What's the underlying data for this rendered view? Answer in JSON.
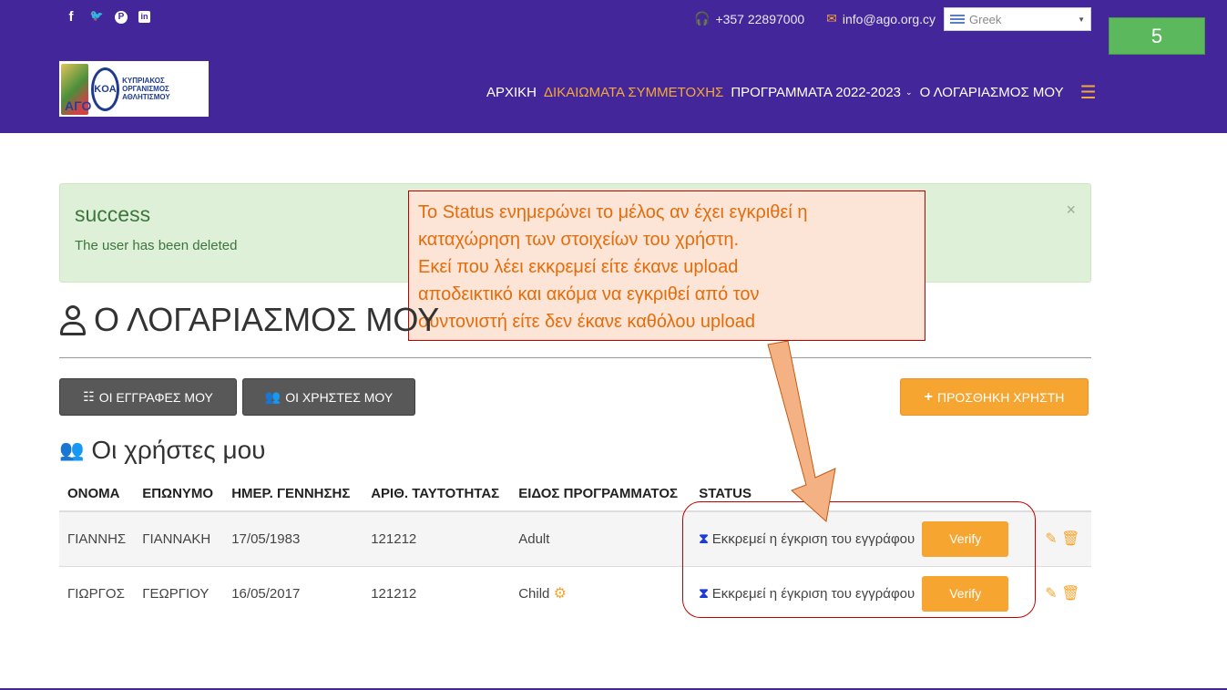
{
  "header": {
    "social": [
      "f",
      "🐦",
      "P",
      "in"
    ],
    "phone": "+357 22897000",
    "email": "info@ago.org.cy",
    "language": "Greek",
    "logo_initials": "AΓΟ",
    "logo_text": "ΚΥΠΡΙΑΚΟΣ ΟΡΓΑΝΙΣΜΟΣ ΑΘΛΗΤΙΣΜΟΥ",
    "nav": {
      "home": "ΑΡΧΙΚΗ",
      "rights": "ΔΙΚΑΙΩΜΑΤΑ ΣΥΜΜΕΤΟΧΗΣ",
      "programs": "ΠΡΟΓΡΑΜΜΑΤΑ 2022-2023",
      "account": "Ο ΛΟΓΑΡΙΑΣΜΟΣ ΜΟΥ"
    }
  },
  "slide_number": "5",
  "alert": {
    "title": "success",
    "message": "The user has been deleted",
    "close": "×"
  },
  "callout": {
    "line1": "Το Status  ενημερώνει το μέλος αν έχει εγκριθεί η",
    "line2": "καταχώρηση των στοιχείων του χρήστη.",
    "line3": "Εκεί που λέει εκκρεμεί είτε έκανε upload",
    "line4": "αποδεικτικό και ακόμα να εγκριθεί από τον",
    "line5": "συντονιστή είτε δεν έκανε καθόλου upload"
  },
  "page_title": "Ο ΛΟΓΑΡΙΑΣΜΟΣ ΜΟΥ",
  "buttons": {
    "my_registrations": "ΟΙ ΕΓΓΡΑΦΕΣ ΜΟΥ",
    "my_users": "ΟΙ ΧΡΗΣΤΕΣ ΜΟΥ",
    "add_user": "ΠΡΟΣΘΗΚΗ ΧΡΗΣΤΗ"
  },
  "section_title": "Οι χρήστες μου",
  "table": {
    "headers": [
      "ΟΝΟΜΑ",
      "ΕΠΩΝΥΜΟ",
      "ΗΜΕΡ. ΓΕΝΝΗΣΗΣ",
      "ΑΡΙΘ. ΤΑΥΤΟΤΗΤΑΣ",
      "ΕΙΔΟΣ ΠΡΟΓΡΑΜΜΑΤΟΣ",
      "STATUS"
    ],
    "rows": [
      {
        "first": "ΓΙΑΝΝΗΣ",
        "last": "ΓΙΑΝΝΑΚΗ",
        "dob": "17/05/1983",
        "id": "121212",
        "program": "Adult",
        "status": "Εκκρεμεί η έγκριση του εγγράφου",
        "verify": "Verify"
      },
      {
        "first": "ΓΙΩΡΓΟΣ",
        "last": "ΓΕΩΡΓΙΟΥ",
        "dob": "16/05/2017",
        "id": "121212",
        "program": "Child",
        "status": "Εκκρεμεί η έγκριση του εγγράφου",
        "verify": "Verify"
      }
    ]
  },
  "colors": {
    "header_bg": "#43279a",
    "accent": "#f7a531",
    "alert_bg": "#dff0d8",
    "callout_bg": "#fce4d6",
    "callout_border": "#c00000"
  }
}
